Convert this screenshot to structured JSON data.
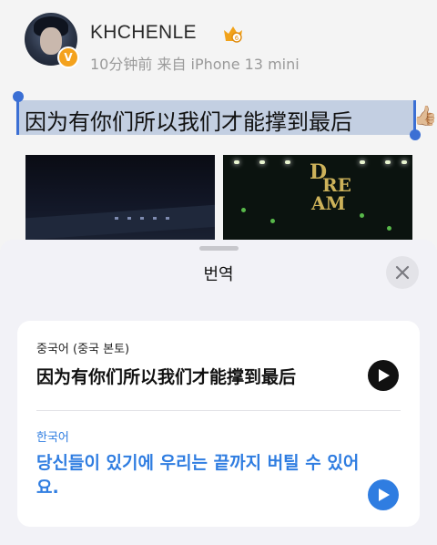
{
  "post": {
    "username": "KHCHENLE",
    "verified_badge": "V",
    "meta": "10分钟前 来自 iPhone 13 mini",
    "selected_text": "因为有你们所以我们才能撑到最后",
    "trailing_emoji": "👍🏼",
    "icons": [
      "avatar",
      "verified-badge-icon",
      "crown-level-icon"
    ],
    "photos": [
      "stage-photo-left",
      "stage-photo-dream"
    ]
  },
  "sheet": {
    "title": "번역",
    "close_icon": "close-icon",
    "source": {
      "language": "중국어 (중국 본토)",
      "text": "因为有你们所以我们才能撑到最后",
      "play_icon": "play-icon"
    },
    "target": {
      "language": "한국어",
      "text": "당신들이 있기에 우리는 끝까지 버틸 수 있어요.",
      "play_icon": "play-icon"
    }
  },
  "colors": {
    "accent": "#2f7de1",
    "selection": "#c3cfe2",
    "handle": "#3b6fd4",
    "badge": "#f4a21d"
  }
}
